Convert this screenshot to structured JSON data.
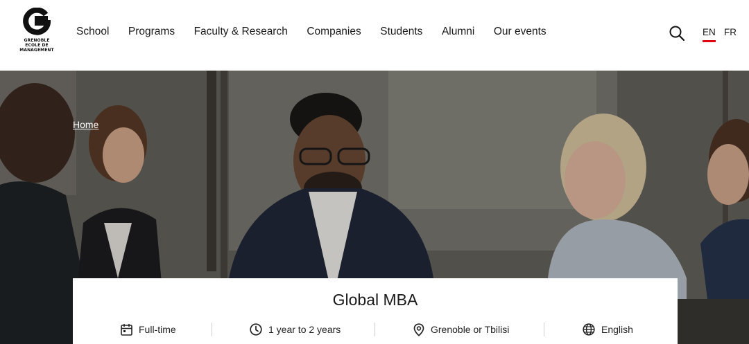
{
  "header": {
    "logo_text": [
      "GRENOBLE",
      "ECOLE DE",
      "MANAGEMENT"
    ],
    "nav": [
      {
        "label": "School"
      },
      {
        "label": "Programs"
      },
      {
        "label": "Faculty & Research"
      },
      {
        "label": "Companies"
      },
      {
        "label": "Students"
      },
      {
        "label": "Alumni"
      },
      {
        "label": "Our events"
      }
    ],
    "search_icon": "search-icon",
    "languages": {
      "en": "EN",
      "fr": "FR",
      "active": "EN"
    }
  },
  "hero": {
    "breadcrumb": "Home",
    "image": "business-meeting-photo"
  },
  "program": {
    "title": "Global MBA",
    "facts": [
      {
        "icon": "calendar-icon",
        "text": "Full-time"
      },
      {
        "icon": "clock-icon",
        "text": "1 year to 2 years"
      },
      {
        "icon": "location-pin-icon",
        "text": "Grenoble or Tbilisi"
      },
      {
        "icon": "globe-icon",
        "text": "English"
      }
    ]
  },
  "colors": {
    "accent": "#e30613",
    "text": "#1a1a1a",
    "background": "#ffffff"
  }
}
